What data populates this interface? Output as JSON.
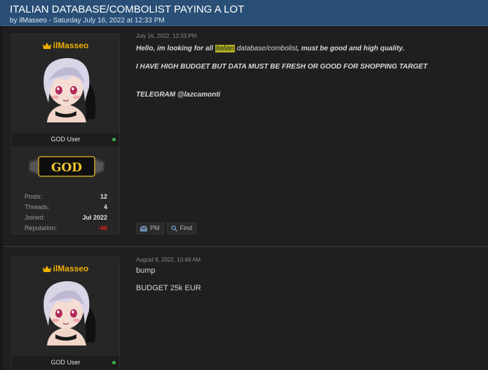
{
  "thread": {
    "title": "ITALIAN DATABASE/COMBOLIST PAYING A LOT",
    "by_prefix": "by",
    "author": "ilMasseo",
    "separator": " - ",
    "date": "Saturday July 16, 2022 at 12:33 PM"
  },
  "posts": [
    {
      "author": "ilMasseo",
      "user_title": "GOD User",
      "rank_badge": "GOD",
      "stats": {
        "posts_label": "Posts:",
        "posts": "12",
        "threads_label": "Threads:",
        "threads": "4",
        "joined_label": "Joined:",
        "joined": "Jul 2022",
        "reputation_label": "Reputation:",
        "reputation": "-40"
      },
      "date": "July 16, 2022, 12:33 PM",
      "body": {
        "line1_pre": "Hello, im looking for all ",
        "line1_hl": "italian",
        "line1_mid": " database/combolist",
        "line1_post": ", must be good and high quality.",
        "line2": "I HAVE HIGH BUDGET BUT DATA MUST BE FRESH OR GOOD FOR SHOPPING TARGET",
        "line3": "TELEGRAM @lazcamonti"
      },
      "actions": {
        "pm": "PM",
        "find": "Find"
      }
    },
    {
      "author": "ilMasseo",
      "user_title": "GOD User",
      "date": "August 9, 2022, 10:49 AM",
      "body": {
        "line1": "bump",
        "line2": "BUDGET 25k EUR"
      }
    }
  ],
  "colors": {
    "header_bg": "#294f76",
    "page_bg": "#1f1f1f",
    "username": "#f0b000",
    "highlight": "#b0b020",
    "online": "#3bb54a",
    "negative": "#e02020"
  }
}
